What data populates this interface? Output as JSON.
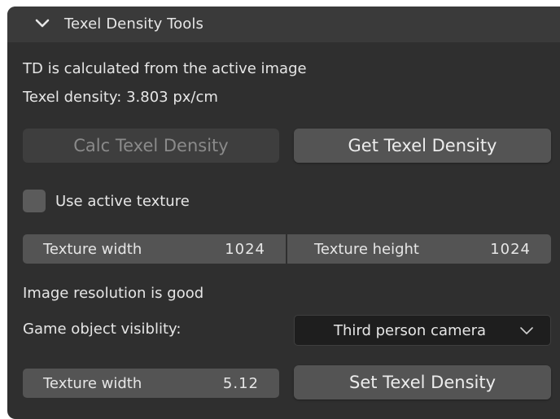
{
  "panel": {
    "title": "Texel Density Tools",
    "info_line": "TD is calculated from the active image",
    "density_line": "Texel density: 3.803 px/cm"
  },
  "buttons": {
    "calc_label": "Calc Texel Density",
    "get_label": "Get Texel Density",
    "set_label": "Set Texel Density"
  },
  "use_active_texture": {
    "label": "Use active texture",
    "checked": false
  },
  "texture_fields": {
    "width_label": "Texture width",
    "width_value": "1024",
    "height_label": "Texture height",
    "height_value": "1024"
  },
  "status": {
    "resolution_text": "Image resolution is good",
    "visibility_label": "Game object visiblity:"
  },
  "visibility_dropdown": {
    "selected": "Third person camera"
  },
  "bottom_field": {
    "label": "Texture width",
    "value": "5.12"
  },
  "colors": {
    "panel_bg": "#2f2f2f",
    "header_bg": "#3a3a3a",
    "button_bg": "#545454",
    "dropdown_bg": "#1e1e1e",
    "text": "#e6e6e6",
    "disabled_text": "#8a8a8a"
  }
}
